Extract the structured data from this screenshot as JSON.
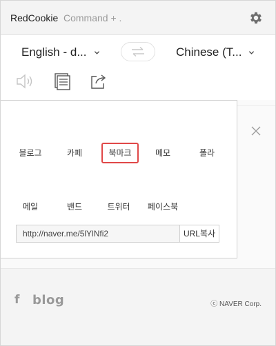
{
  "titlebar": {
    "app_name": "RedCookie",
    "shortcut": "Command + ."
  },
  "languages": {
    "source": "English - d...",
    "target": "Chinese (T..."
  },
  "share": {
    "services": [
      {
        "label": "블로그"
      },
      {
        "label": "카페"
      },
      {
        "label": "북마크",
        "selected": true
      },
      {
        "label": "메모"
      },
      {
        "label": "폴라"
      },
      {
        "label": "메일"
      },
      {
        "label": "밴드"
      },
      {
        "label": "트위터"
      },
      {
        "label": "페이스북"
      }
    ],
    "url_value": "http://naver.me/5lYlNfi2",
    "url_copy_label": "URL복사"
  },
  "footer": {
    "facebook_glyph": "f",
    "blog_glyph": "blog",
    "copyright": "ⓒ NAVER Corp."
  },
  "colors": {
    "selected_border": "#e04848",
    "icon_grey": "#999999"
  }
}
